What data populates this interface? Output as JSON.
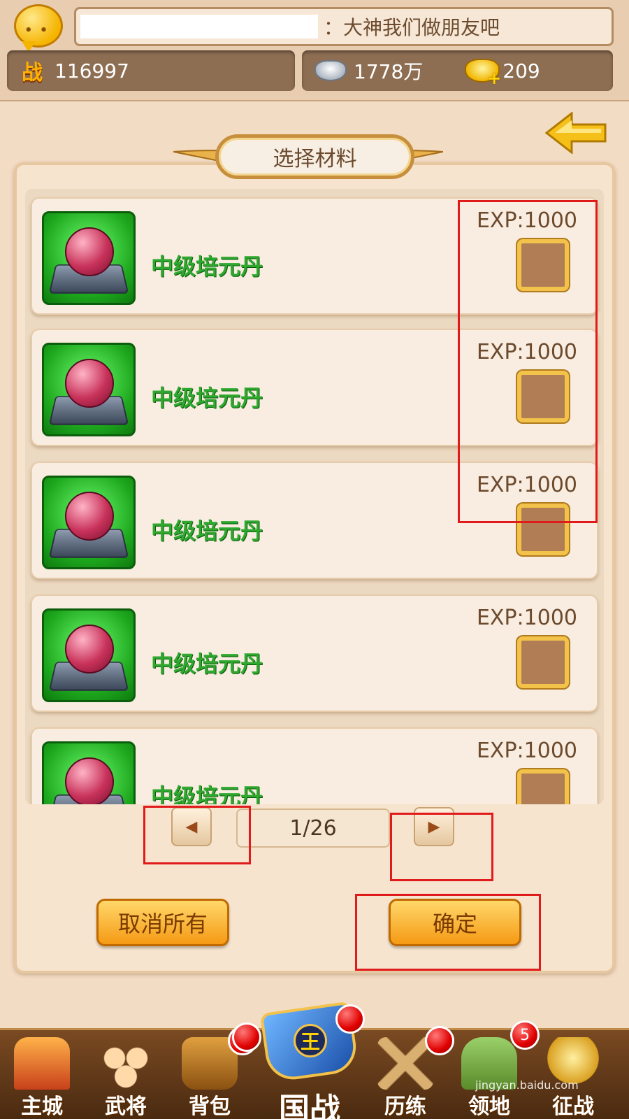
{
  "chat": {
    "message": "：大神我们做朋友吧"
  },
  "resources": {
    "power_glyph": "战",
    "power": "116997",
    "silver": "1778万",
    "gold": "209"
  },
  "dialog": {
    "title": "选择材料"
  },
  "items": [
    {
      "name": "中级培元丹",
      "exp": "EXP:1000"
    },
    {
      "name": "中级培元丹",
      "exp": "EXP:1000"
    },
    {
      "name": "中级培元丹",
      "exp": "EXP:1000"
    },
    {
      "name": "中级培元丹",
      "exp": "EXP:1000"
    },
    {
      "name": "中级培元丹",
      "exp": "EXP:1000"
    }
  ],
  "pager": {
    "display": "1/26",
    "prev": "◀",
    "next": "▶"
  },
  "buttons": {
    "cancel_all": "取消所有",
    "confirm": "确定"
  },
  "nav": {
    "main_city": "主城",
    "generals": "武将",
    "backpack": "背包",
    "national_war": "国战",
    "national_war_emblem": "王",
    "training": "历练",
    "territory": "领地",
    "campaign": "征战",
    "territory_badge": "5"
  },
  "watermark": "jingyan.baidu.com",
  "colors": {
    "highlight": "#e11b1b",
    "item_name": "#2ea82e",
    "accent_gold": "#f2c24a"
  }
}
